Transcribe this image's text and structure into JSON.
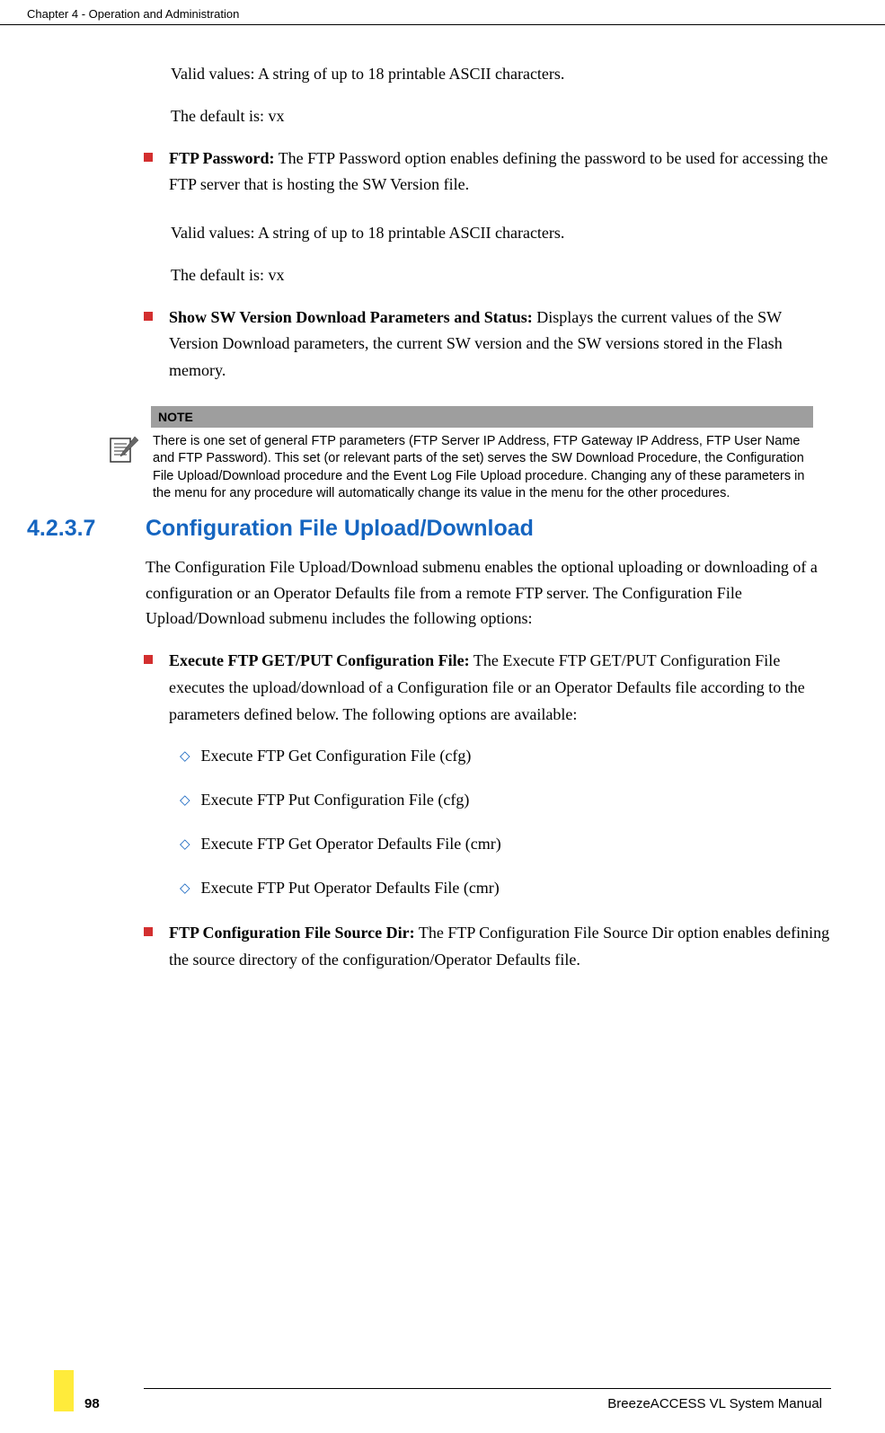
{
  "header": {
    "chapter": "Chapter 4 - Operation and Administration"
  },
  "body": {
    "p1": "Valid values: A string of up to 18 printable ASCII characters.",
    "p2": "The default is: vx",
    "b1_bold": "FTP Password:",
    "b1_text": " The FTP Password option enables defining the password to be used for accessing the FTP server that is hosting the SW Version file.",
    "p3": "Valid values: A string of up to 18 printable ASCII characters.",
    "p4": "The default is: vx",
    "b2_bold": "Show SW Version Download Parameters and Status:",
    "b2_text": " Displays the current values of the SW Version Download parameters, the current SW version and the SW versions stored in the Flash memory.",
    "note_label": "NOTE",
    "note_text": "There is one set of general FTP parameters (FTP Server IP Address, FTP Gateway IP Address, FTP User Name and FTP Password). This set (or relevant parts of the set) serves the SW Download Procedure, the Configuration File Upload/Download procedure and the Event Log File Upload procedure. Changing any of these parameters in the menu for any procedure will automatically change its value in the menu for the other procedures.",
    "section_num": "4.2.3.7",
    "section_title": "Configuration File Upload/Download",
    "p5": "The Configuration File Upload/Download submenu enables the optional uploading or downloading of a configuration or an Operator Defaults file from a remote FTP server. The Configuration File Upload/Download submenu includes the following options:",
    "b3_bold": "Execute FTP GET/PUT Configuration File:",
    "b3_text": " The Execute FTP GET/PUT Configuration File executes the upload/download of a Configuration file or an Operator Defaults file according to the parameters defined below. The following options are available:",
    "d1": "Execute FTP Get Configuration File (cfg)",
    "d2": "Execute FTP Put Configuration File (cfg)",
    "d3": "Execute FTP Get Operator Defaults File (cmr)",
    "d4": "Execute FTP Put Operator Defaults File (cmr)",
    "b4_bold": "FTP Configuration File Source Dir:",
    "b4_text": " The FTP Configuration File Source Dir option enables defining the source directory of the configuration/Operator Defaults file."
  },
  "footer": {
    "page": "98",
    "title": "BreezeACCESS VL System Manual"
  }
}
